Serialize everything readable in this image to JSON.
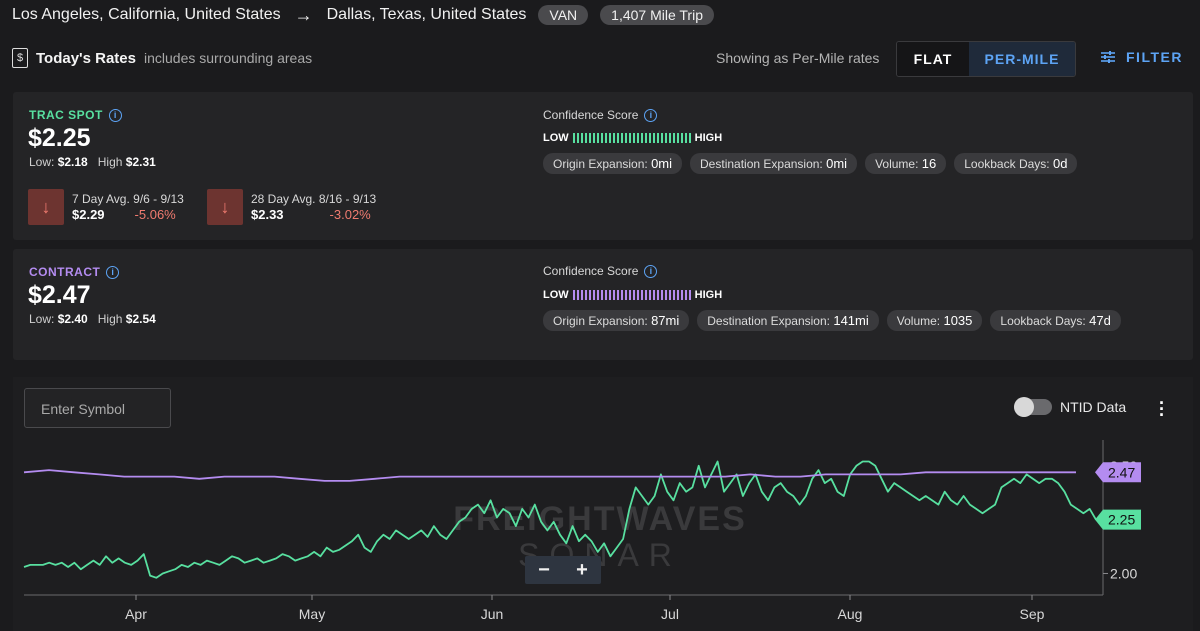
{
  "route": {
    "origin": "Los Angeles, California, United States",
    "destination": "Dallas, Texas, United States",
    "equipment": "VAN",
    "trip": "1,407 Mile Trip"
  },
  "rates_header": {
    "title": "Today's Rates",
    "subtitle": "includes surrounding areas",
    "showing": "Showing as Per-Mile rates",
    "flat_label": "FLAT",
    "per_mile_label": "PER-MILE",
    "filter_label": "FILTER"
  },
  "spot": {
    "label": "TRAC SPOT",
    "price": "$2.25",
    "low_label": "Low:",
    "low": "$2.18",
    "high_label": "High",
    "high": "$2.31",
    "avg7": {
      "label": "7 Day Avg. 9/6 - 9/13",
      "value": "$2.29",
      "change": "-5.06%"
    },
    "avg28": {
      "label": "28 Day Avg. 8/16 - 9/13",
      "value": "$2.33",
      "change": "-3.02%"
    },
    "confidence": {
      "title": "Confidence Score",
      "low": "LOW",
      "high": "HIGH",
      "color": "#58e0a0",
      "chips": [
        {
          "label": "Origin Expansion:",
          "value": "0mi"
        },
        {
          "label": "Destination Expansion:",
          "value": "0mi"
        },
        {
          "label": "Volume:",
          "value": "16"
        },
        {
          "label": "Lookback Days:",
          "value": "0d"
        }
      ]
    }
  },
  "contract": {
    "label": "CONTRACT",
    "price": "$2.47",
    "low_label": "Low:",
    "low": "$2.40",
    "high_label": "High",
    "high": "$2.54",
    "confidence": {
      "title": "Confidence Score",
      "low": "LOW",
      "high": "HIGH",
      "color": "#b48cf0",
      "chips": [
        {
          "label": "Origin Expansion:",
          "value": "87mi"
        },
        {
          "label": "Destination Expansion:",
          "value": "141mi"
        },
        {
          "label": "Volume:",
          "value": "1035"
        },
        {
          "label": "Lookback Days:",
          "value": "47d"
        }
      ]
    }
  },
  "chart_controls": {
    "symbol_placeholder": "Enter Symbol",
    "ntid_label": "NTID Data",
    "zoom_out": "−",
    "zoom_in": "+",
    "watermark_1": "FREIGHTWAVES",
    "watermark_2": "SONAR"
  },
  "chart_data": {
    "type": "line",
    "x_labels": [
      "Apr",
      "May",
      "Jun",
      "Jul",
      "Aug",
      "Sep"
    ],
    "y_ticks": [
      "2.00",
      "2.50"
    ],
    "ylim": [
      1.9,
      2.62
    ],
    "series": [
      {
        "name": "TRAC SPOT",
        "color": "#58e0a0",
        "last_label": "2.25",
        "values": [
          2.03,
          2.04,
          2.04,
          2.04,
          2.05,
          2.04,
          2.05,
          2.03,
          2.05,
          2.02,
          2.04,
          2.06,
          2.04,
          2.08,
          2.05,
          2.07,
          2.05,
          2.04,
          2.06,
          2.09,
          1.99,
          1.98,
          2.0,
          2.01,
          2.02,
          2.04,
          2.03,
          2.05,
          2.04,
          2.06,
          2.05,
          2.04,
          2.06,
          2.08,
          2.07,
          2.05,
          2.06,
          2.07,
          2.05,
          2.06,
          2.07,
          2.09,
          2.08,
          2.06,
          2.07,
          2.08,
          2.1,
          2.08,
          2.12,
          2.1,
          2.11,
          2.13,
          2.15,
          2.18,
          2.12,
          2.1,
          2.15,
          2.18,
          2.16,
          2.2,
          2.18,
          2.16,
          2.18,
          2.2,
          2.17,
          2.22,
          2.18,
          2.16,
          2.2,
          2.24,
          2.26,
          2.3,
          2.32,
          2.28,
          2.34,
          2.26,
          2.3,
          2.28,
          2.22,
          2.3,
          2.26,
          2.32,
          2.24,
          2.2,
          2.24,
          2.18,
          2.14,
          2.22,
          2.15,
          2.18,
          2.15,
          2.1,
          2.14,
          2.08,
          2.12,
          2.16,
          2.3,
          2.4,
          2.36,
          2.32,
          2.36,
          2.46,
          2.38,
          2.34,
          2.42,
          2.38,
          2.4,
          2.5,
          2.4,
          2.46,
          2.52,
          2.38,
          2.42,
          2.46,
          2.36,
          2.42,
          2.46,
          2.38,
          2.34,
          2.4,
          2.42,
          2.38,
          2.36,
          2.32,
          2.36,
          2.44,
          2.48,
          2.42,
          2.44,
          2.38,
          2.36,
          2.46,
          2.5,
          2.52,
          2.52,
          2.5,
          2.44,
          2.38,
          2.42,
          2.4,
          2.38,
          2.36,
          2.34,
          2.36,
          2.34,
          2.32,
          2.38,
          2.34,
          2.32,
          2.36,
          2.32,
          2.3,
          2.28,
          2.3,
          2.32,
          2.4,
          2.42,
          2.44,
          2.42,
          2.46,
          2.44,
          2.42,
          2.44,
          2.44,
          2.42,
          2.38,
          2.32,
          2.3,
          2.28,
          2.3,
          2.25
        ]
      },
      {
        "name": "CONTRACT",
        "color": "#b48cf0",
        "last_label": "2.47",
        "values": [
          2.47,
          2.48,
          2.47,
          2.46,
          2.45,
          2.45,
          2.45,
          2.44,
          2.45,
          2.45,
          2.45,
          2.44,
          2.43,
          2.43,
          2.44,
          2.45,
          2.45,
          2.45,
          2.45,
          2.45,
          2.45,
          2.45,
          2.45,
          2.45,
          2.45,
          2.45,
          2.45,
          2.45,
          2.45,
          2.46,
          2.45,
          2.45,
          2.46,
          2.46,
          2.46,
          2.46,
          2.47,
          2.47,
          2.47,
          2.47,
          2.47,
          2.47,
          2.47
        ]
      }
    ]
  }
}
